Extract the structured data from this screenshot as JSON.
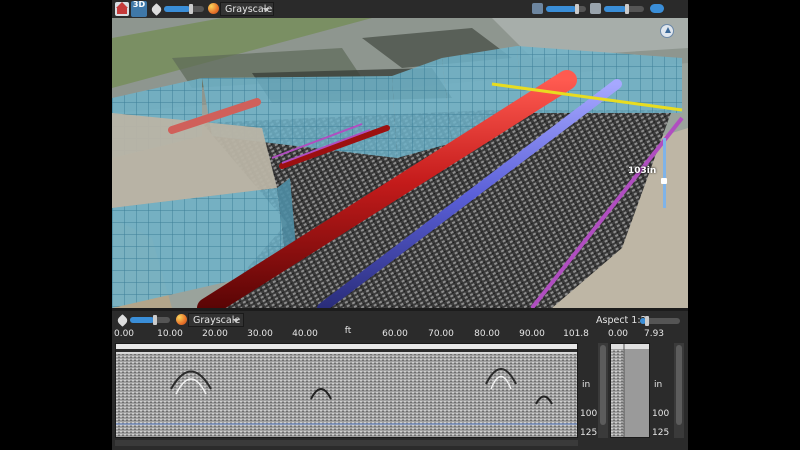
{
  "top_toolbar": {
    "mode_3d_label": "3D",
    "palette": "Grayscale"
  },
  "viewport_3d": {
    "depth_value": "103in"
  },
  "panel_2d": {
    "palette": "Grayscale",
    "aspect_label": "Aspect 1:2",
    "distance_unit": "ft",
    "distance_ticks": [
      "0.00",
      "10.00",
      "20.00",
      "30.00",
      "40.00",
      "60.00",
      "70.00",
      "80.00",
      "90.00",
      "101.8"
    ],
    "depth_unit": "in",
    "depth_ticks": [
      "100",
      "125"
    ],
    "side_ticks": [
      "0.00",
      "7.93"
    ],
    "side_depth_unit": "in",
    "side_depth_ticks": [
      "100",
      "125"
    ]
  },
  "colors": {
    "pipe_red": "#b01818",
    "pipe_salmon": "#d0605a",
    "pipe_blue": "#5a5fd8",
    "line_magenta": "#b04ec0",
    "line_yellow": "#e8dc20",
    "wall": "#6fb3c9",
    "accent": "#3a8ed8"
  }
}
